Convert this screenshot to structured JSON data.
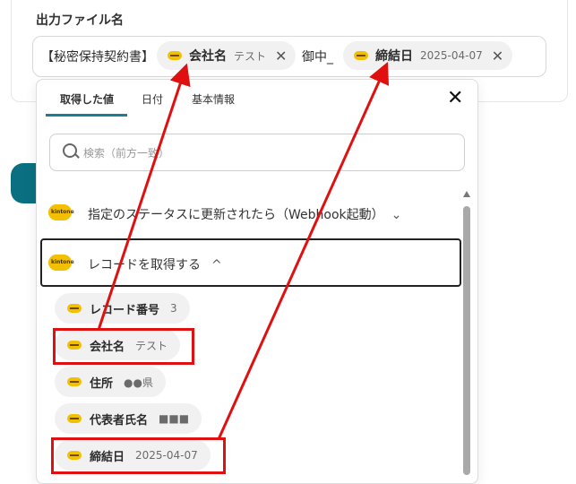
{
  "field": {
    "label": "出力ファイル名",
    "prefix_text": "【秘密保持契約書】",
    "middle_text": "御中_",
    "chips": [
      {
        "name": "会社名",
        "value": "テスト"
      },
      {
        "name": "締結日",
        "value": "2025-04-07"
      }
    ],
    "remove_glyph": "✕"
  },
  "dropdown": {
    "tabs": [
      {
        "label": "取得した値",
        "active": true
      },
      {
        "label": "日付",
        "active": false
      },
      {
        "label": "基本情報",
        "active": false
      }
    ],
    "close_glyph": "✕",
    "search": {
      "placeholder": "検索（前方一致）"
    },
    "badge_text": "kintone",
    "trigger": {
      "label": "指定のステータスに更新されたら（Webhook起動）",
      "chevron": "⌄"
    },
    "section": {
      "label": "レコードを取得する",
      "chevron": "^"
    },
    "items": [
      {
        "name": "レコード番号",
        "value": "3"
      },
      {
        "name": "会社名",
        "value": "テスト"
      },
      {
        "name": "住所",
        "value": "●●県"
      },
      {
        "name": "代表者氏名",
        "value": "■■■"
      },
      {
        "name": "締結日",
        "value": "2025-04-07"
      }
    ]
  },
  "colors": {
    "accent": "#1b7f91",
    "highlight": "#e01010",
    "kintone": "#f2c000"
  }
}
